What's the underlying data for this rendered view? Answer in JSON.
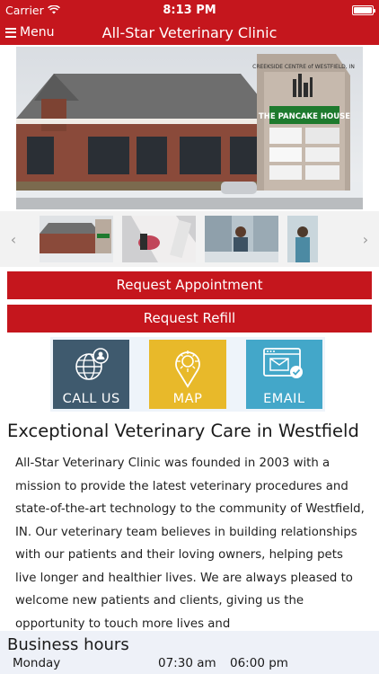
{
  "status_bar": {
    "carrier": "Carrier",
    "time": "8:13 PM"
  },
  "nav": {
    "menu_label": "Menu",
    "title": "All-Star Veterinary Clinic"
  },
  "hero": {
    "sign_top": "CREEKSIDE CENTRE of WESTFIELD, IN",
    "sign_store": "THE PANCAKE HOUSE"
  },
  "gallery": {
    "prev_icon": "chevron-left-icon",
    "next_icon": "chevron-right-icon"
  },
  "actions": {
    "request_appointment": "Request Appointment",
    "request_refill": "Request Refill"
  },
  "tiles": [
    {
      "label": "CALL US",
      "icon": "globe-person-icon",
      "color": "#3f5a6e"
    },
    {
      "label": "MAP",
      "icon": "map-pin-icon",
      "color": "#e8b92a"
    },
    {
      "label": "EMAIL",
      "icon": "email-browser-icon",
      "color": "#43a7c9"
    }
  ],
  "content": {
    "heading": "Exceptional Veterinary Care in Westfield",
    "about": "All-Star Veterinary Clinic was founded in 2003 with a mission to provide the latest veterinary procedures and state-of-the-art technology to the community of Westfield, IN. Our veterinary team believes in building relationships with our patients and their loving owners, helping pets live longer and healthier lives. We are always pleased to welcome new patients and clients, giving us the opportunity to touch more lives and"
  },
  "hours": {
    "heading": "Business hours",
    "rows": [
      {
        "day": "Monday",
        "open": "07:30 am",
        "close": "06:00 pm"
      }
    ]
  },
  "colors": {
    "brand_red": "#c5161d",
    "call_tile": "#3f5a6e",
    "map_tile": "#e8b92a",
    "email_tile": "#43a7c9"
  }
}
